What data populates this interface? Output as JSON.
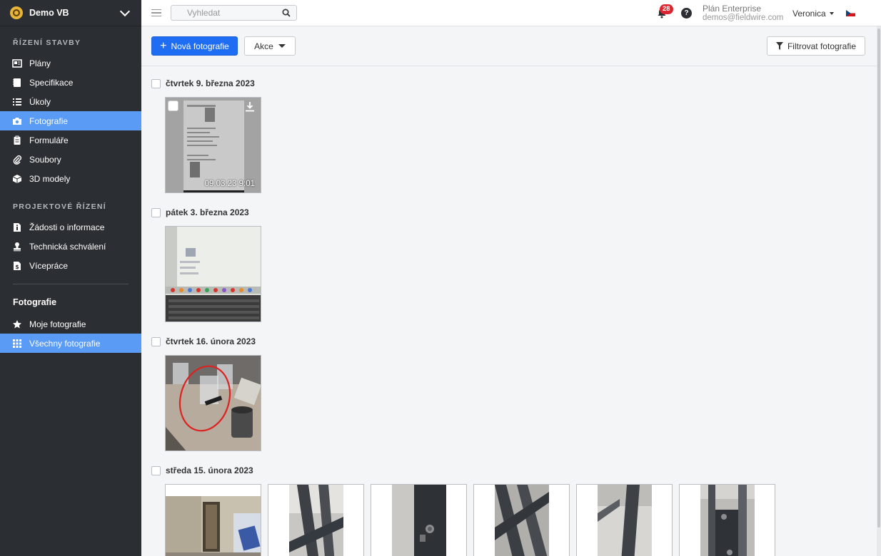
{
  "sidebar": {
    "project_name": "Demo VB",
    "section_construction": "ŘÍZENÍ STAVBY",
    "construction_items": [
      {
        "label": "Plány",
        "icon": "plans-icon"
      },
      {
        "label": "Specifikace",
        "icon": "specs-icon"
      },
      {
        "label": "Úkoly",
        "icon": "tasks-icon"
      },
      {
        "label": "Fotografie",
        "icon": "camera-icon",
        "active": true
      },
      {
        "label": "Formuláře",
        "icon": "clipboard-icon"
      },
      {
        "label": "Soubory",
        "icon": "paperclip-icon"
      },
      {
        "label": "3D modely",
        "icon": "cube-icon"
      }
    ],
    "section_project": "PROJEKTOVÉ ŘÍZENÍ",
    "project_items": [
      {
        "label": "Žádosti o informace",
        "icon": "info-doc-icon"
      },
      {
        "label": "Technická schválení",
        "icon": "stamp-icon"
      },
      {
        "label": "Vícepráce",
        "icon": "dollar-doc-icon"
      }
    ],
    "photos_heading": "Fotografie",
    "photo_items": [
      {
        "label": "Moje fotografie",
        "icon": "star-icon"
      },
      {
        "label": "Všechny fotografie",
        "icon": "grid-icon",
        "active": true
      }
    ]
  },
  "topbar": {
    "search_placeholder": "Vyhledat",
    "notifications_count": "28",
    "plan_name": "Plán Enterprise",
    "email": "demos@fieldwire.com",
    "user_name": "Veronica"
  },
  "actions": {
    "new_photo": "Nová fotografie",
    "akce": "Akce",
    "filter": "Filtrovat fotografie"
  },
  "groups": [
    {
      "date": "čtvrtek 9. března 2023",
      "photos": [
        {
          "timestamp": "09.03.23 9:01"
        }
      ]
    },
    {
      "date": "pátek 3. března 2023",
      "photos": [
        {}
      ]
    },
    {
      "date": "čtvrtek 16. února 2023",
      "photos": [
        {}
      ]
    },
    {
      "date": "středa 15. února 2023",
      "photos": [
        {},
        {},
        {},
        {},
        {},
        {}
      ]
    }
  ],
  "colors": {
    "sidebar_bg": "#2b2f33",
    "active_item": "#5a9bf6",
    "primary_button": "#1e6df2",
    "badge": "#d9262f"
  }
}
